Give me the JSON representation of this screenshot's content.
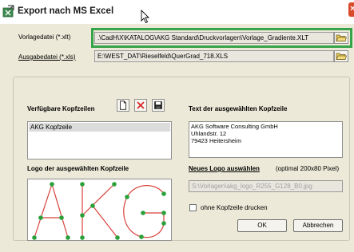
{
  "window": {
    "title": "Export nach MS Excel",
    "close_glyph": "×"
  },
  "fields": {
    "template_label": "Vorlagedatei (*.xlt)",
    "template_value": ".\\CadH\\X\\KATALOG\\AKG Standard\\Druckvorlagen\\Vorlage_Gradiente.XLT",
    "output_label": "Ausgabedatei (*.xls)",
    "output_value": "E:\\WEST_DAT\\Rieselfeld\\QuerGrad_718.XLS"
  },
  "headers": {
    "available_label": "Verfügbare Kopfzeilen",
    "items": [
      "AKG Kopfzeile"
    ],
    "text_label": "Text der ausgewählten Kopfzeile",
    "text_value": "AKG Software Consulting GmbH\nUhlandstr. 12\n79423 Heitersheim"
  },
  "logo": {
    "label": "Logo der ausgewählten Kopfzeile",
    "select_label": "Neues Logo auswählen",
    "hint": "(optimal 200x80 Pixel)",
    "path_value": "S:\\Vorlagen\\akg_logo_R255_G128_B0.jpg",
    "logo_text": "AKG",
    "accent_color": "#d9423c",
    "dot_color": "#2aa03a"
  },
  "options": {
    "no_header_label": "ohne Kopfzeile drucken"
  },
  "buttons": {
    "ok": "OK",
    "cancel": "Abbrechen"
  },
  "icons": {
    "app": "excel-export-icon",
    "folder": "folder-open-icon",
    "new": "new-document-icon",
    "delete": "delete-x-icon",
    "save": "floppy-save-icon",
    "cursor": "mouse-cursor-icon",
    "close": "close-icon"
  }
}
